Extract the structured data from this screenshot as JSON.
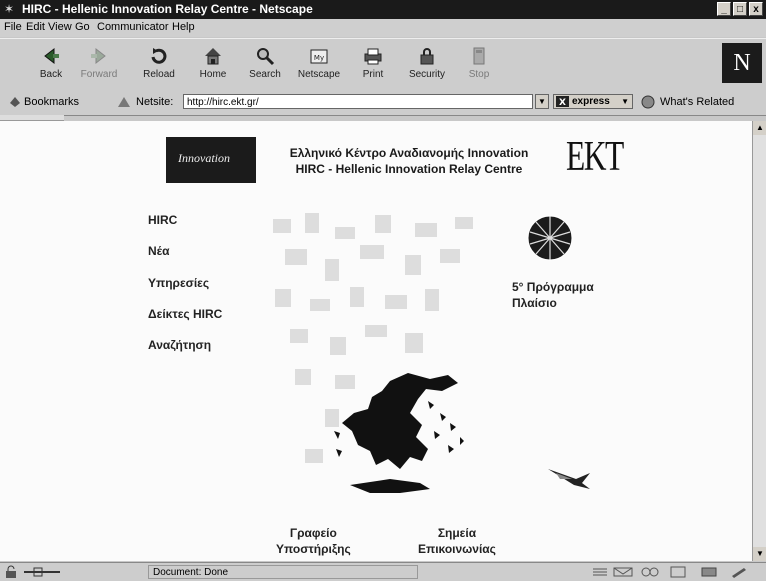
{
  "window": {
    "title": "HIRC - Hellenic Innovation Relay Centre - Netscape",
    "controls": [
      "_",
      "□",
      "x"
    ]
  },
  "menu": [
    "File",
    "Edit",
    "View",
    "Go",
    "Communicator",
    "Help"
  ],
  "toolbar": {
    "buttons": [
      {
        "label": "Back",
        "icon": "back-arrow-icon"
      },
      {
        "label": "Forward",
        "icon": "forward-arrow-icon"
      },
      {
        "label": "Reload",
        "icon": "reload-icon"
      },
      {
        "label": "Home",
        "icon": "home-icon"
      },
      {
        "label": "Search",
        "icon": "search-icon"
      },
      {
        "label": "Netscape",
        "icon": "netscape-icon"
      },
      {
        "label": "Print",
        "icon": "print-icon"
      },
      {
        "label": "Security",
        "icon": "lock-icon"
      },
      {
        "label": "Stop",
        "icon": "stop-icon"
      }
    ],
    "logo": "N"
  },
  "location": {
    "bookmarks_label": "Bookmarks",
    "netsite_label": "Netsite:",
    "url": "http://hirc.ekt.gr/",
    "express_label": "express",
    "related_label": "What's Related"
  },
  "page": {
    "innovation_logo": "Innovation",
    "heading_line1": "Ελληνικό Κέντρο Αναδιανομής Innovation",
    "heading_line2": "HIRC - Hellenic Innovation Relay Centre",
    "ekt_logo": "EKT",
    "nav": [
      "HIRC",
      "Νέα",
      "Υπηρεσίες",
      "Δείκτες HIRC",
      "Αναζήτηση"
    ],
    "program_line1": "5° Πρόγραμμα",
    "program_line2": "Πλαίσιο",
    "footer_left_line1": "Γραφείο",
    "footer_left_line2": "Υποστήριξης",
    "footer_right_line1": "Σημεία",
    "footer_right_line2": "Επικοινωνίας"
  },
  "status": {
    "text": "Document: Done"
  }
}
